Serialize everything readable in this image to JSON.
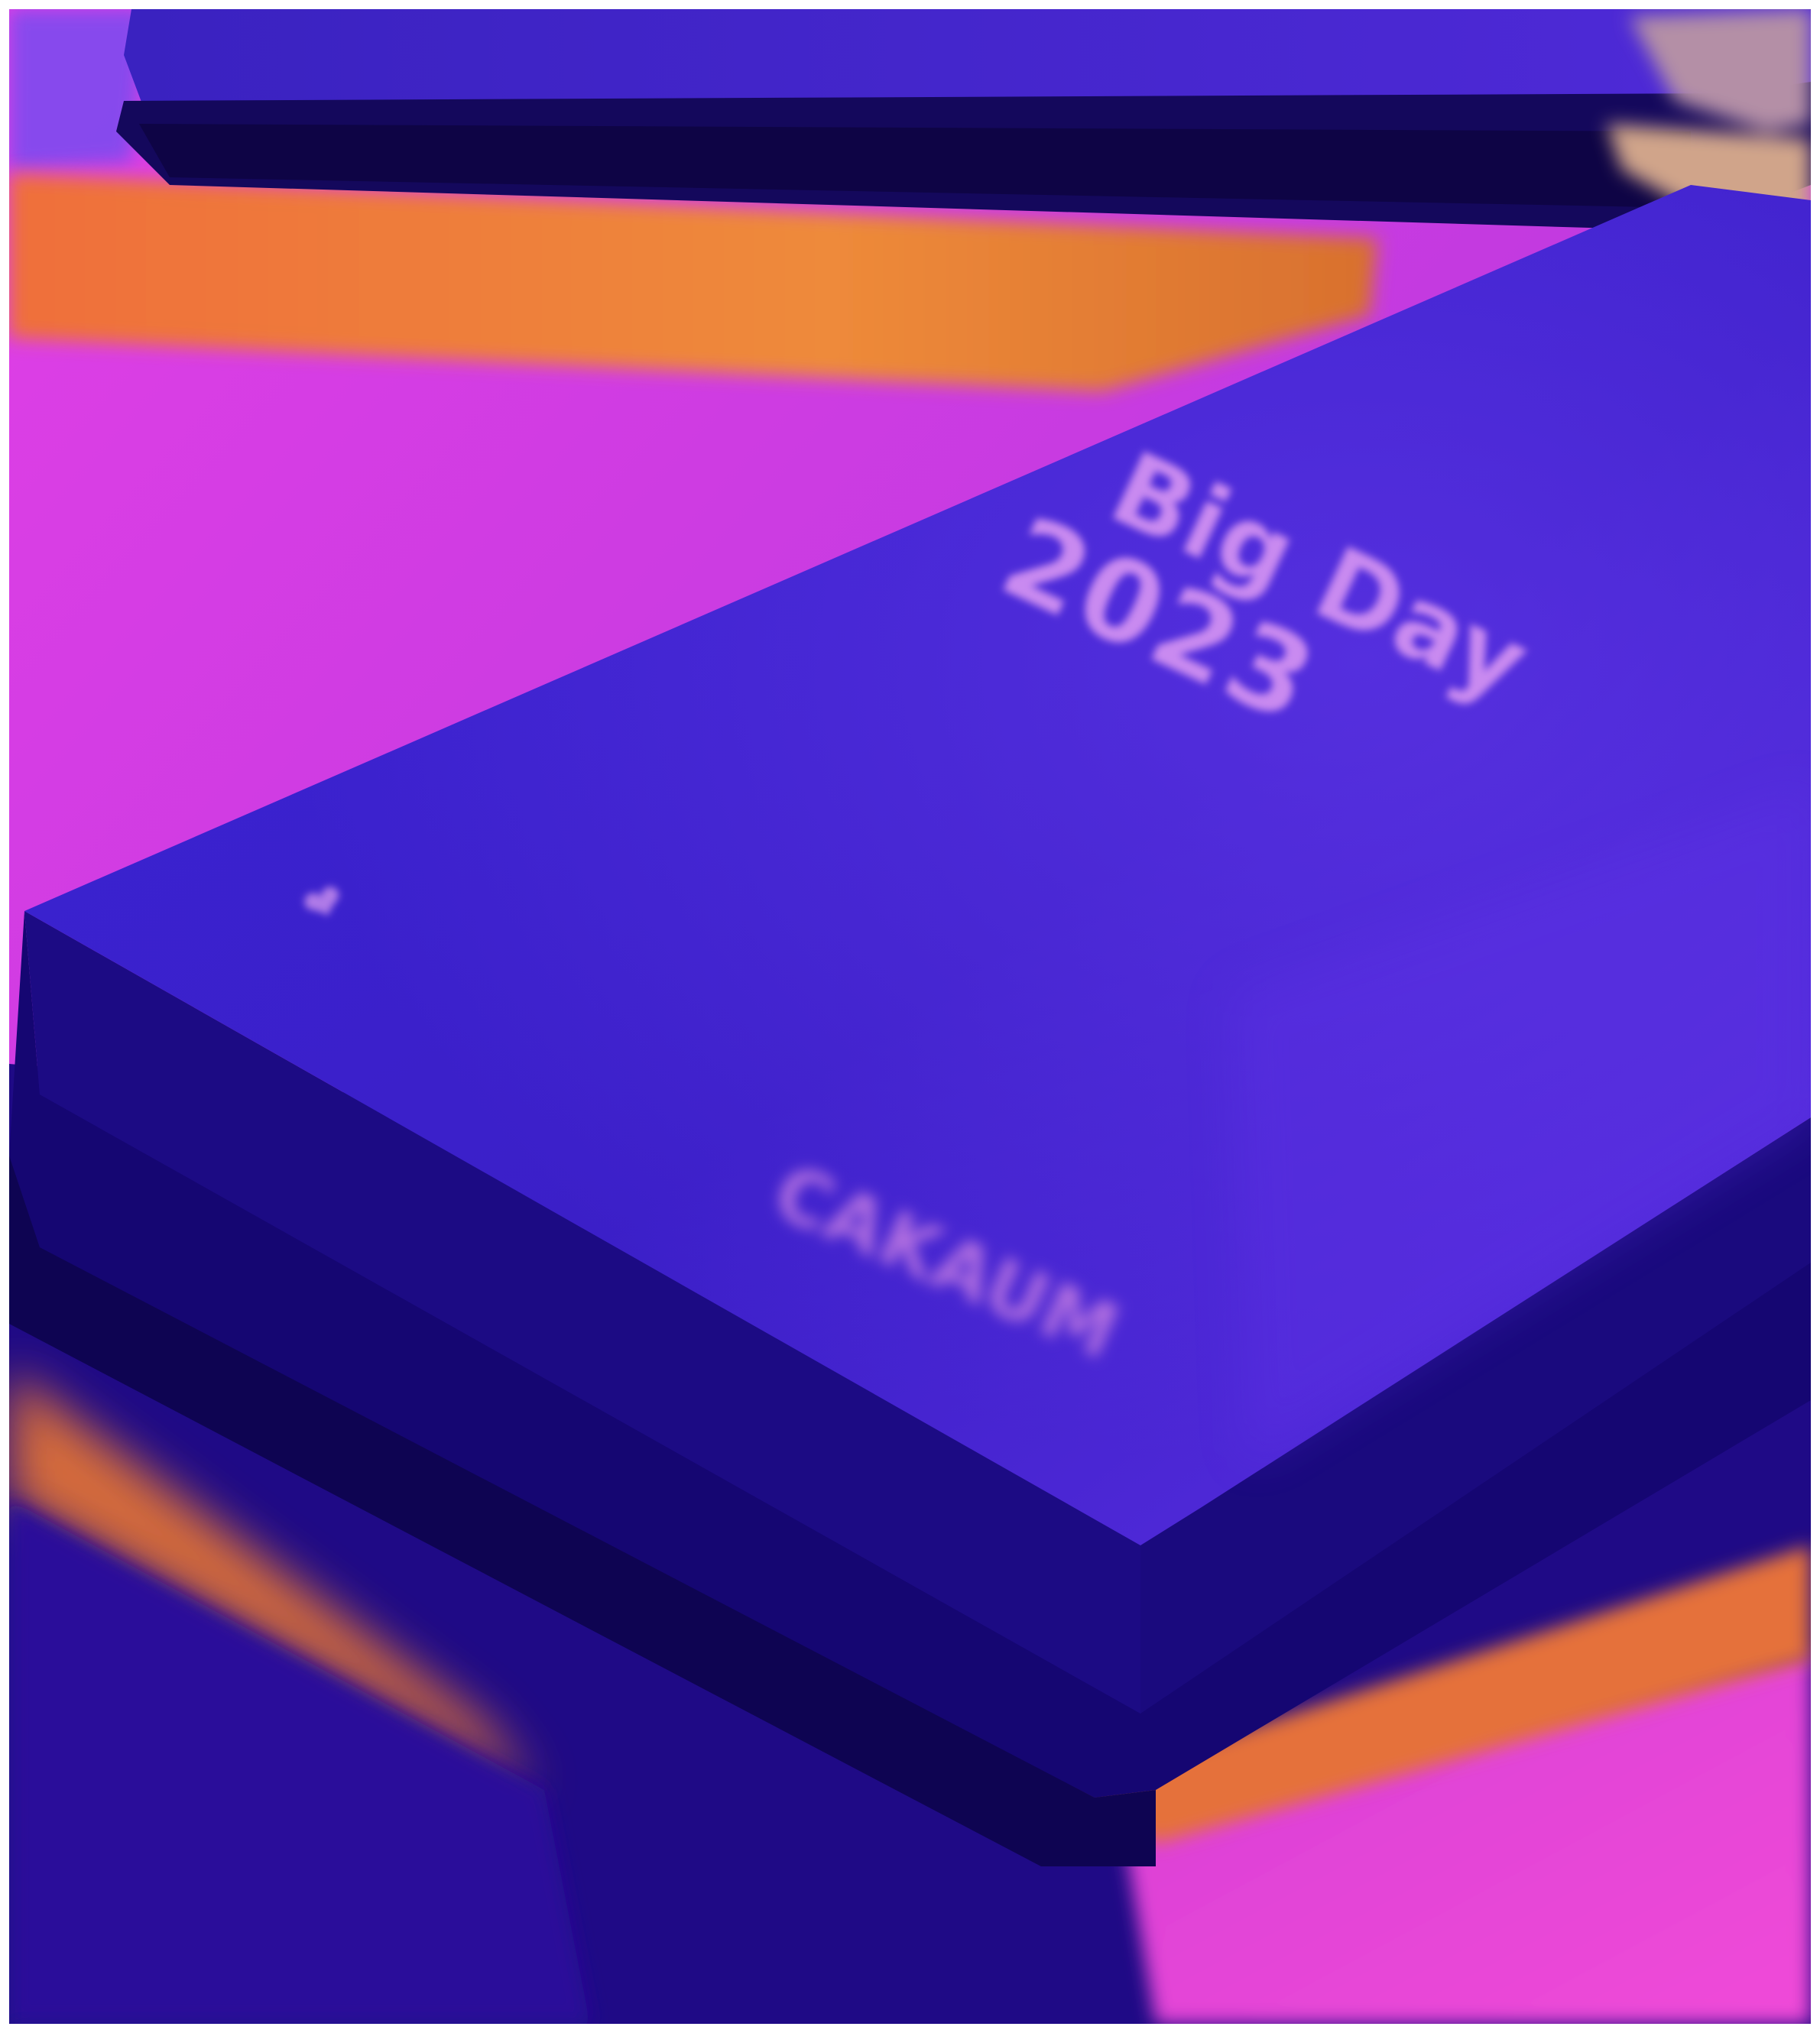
{
  "photo": {
    "notebook": {
      "title_line1": "Big Day",
      "title_line2": "2023",
      "brand_mark": "CAKAUM",
      "heart_icon": "heart-icon"
    },
    "colors": {
      "cover": "#3a1fd0",
      "cover_shadow": "#15086e",
      "surface_magenta": "#e23fe8",
      "surface_orange": "#e87a3a",
      "text_pink": "#c98af0"
    }
  }
}
